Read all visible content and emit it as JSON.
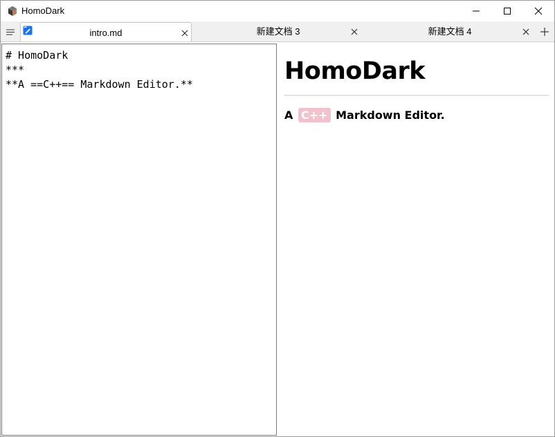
{
  "window": {
    "title": "HomoDark",
    "icon": "homodark-app-icon"
  },
  "tabs": [
    {
      "label": "intro.md",
      "icon": "markdown-file-icon",
      "active": true
    },
    {
      "label": "新建文档 3",
      "active": false
    },
    {
      "label": "新建文档 4",
      "active": false
    }
  ],
  "editor": {
    "lines": [
      "# HomoDark",
      "***",
      "**A ==C++== Markdown Editor.**"
    ]
  },
  "preview": {
    "heading": "HomoDark",
    "para_prefix": "A",
    "para_mark": "C++",
    "para_suffix": "Markdown Editor."
  },
  "colors": {
    "mark_bg": "#f1c2cc",
    "active_tab_icon": "#1a73e8"
  }
}
